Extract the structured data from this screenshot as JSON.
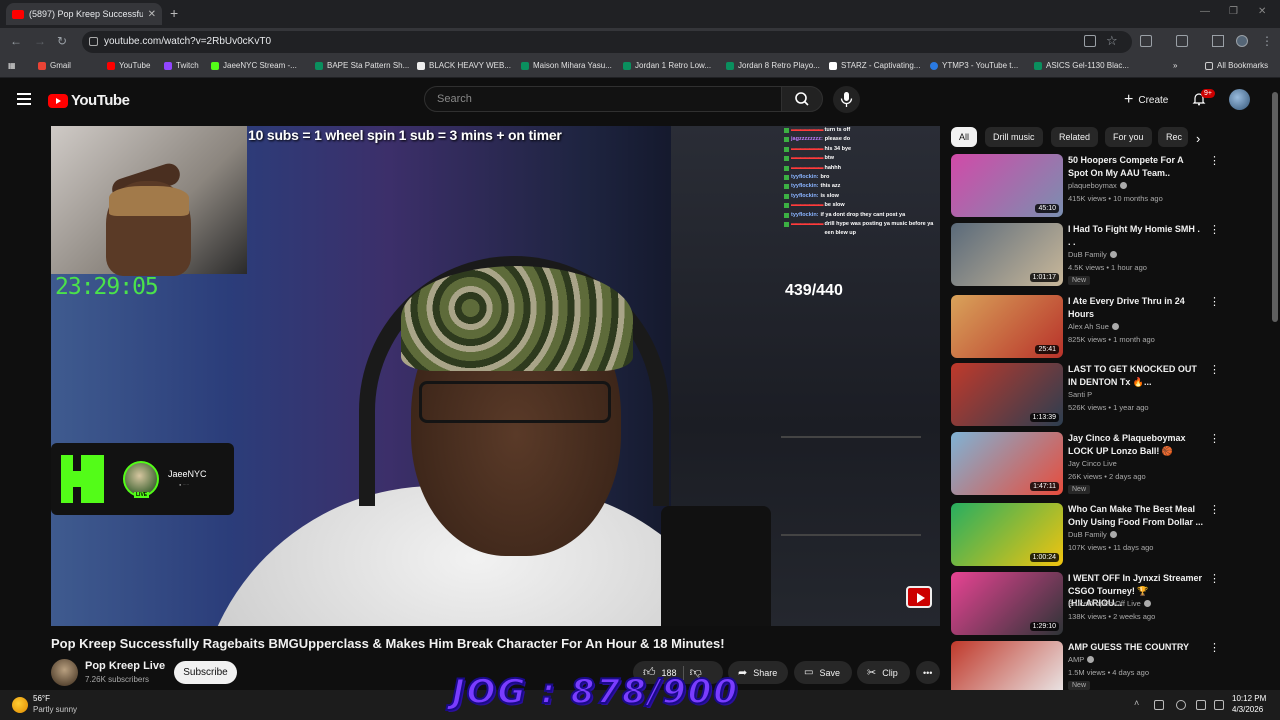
{
  "browser": {
    "tab_title": "(5897) Pop Kreep Successfully R",
    "url": "youtube.com/watch?v=2RbUv0cKvT0",
    "bookmarks": [
      "Gmail",
      "YouTube",
      "Twitch",
      "JaeeNYC Stream -...",
      "BAPE Sta Pattern Sh...",
      "BLACK HEAVY WEB...",
      "Maison Mihara Yasu...",
      "Jordan 1 Retro Low...",
      "Jordan 8 Retro Playo...",
      "STARZ - Captivating...",
      "YTMP3 - YouTube t...",
      "ASICS Gel-1130 Blac..."
    ],
    "all_bookmarks": "All Bookmarks"
  },
  "youtube": {
    "logo": "YouTube",
    "search_placeholder": "Search",
    "create": "Create",
    "notif_badge": "9+"
  },
  "stream": {
    "overlay_text": "10 subs = 1 wheel spin 1 sub = 3 mins + on timer",
    "timer": "23:29:05",
    "sub_goal": "439/440",
    "kick_name": "JaeeNYC",
    "kick_live": "LIVE",
    "chat": [
      {
        "u": "",
        "m": "turn ts off",
        "c": "#ff3b3b"
      },
      {
        "u": "jagzzzzzzzz:",
        "m": "please do",
        "c": "#c07cff"
      },
      {
        "u": "",
        "m": "his 34 bye",
        "c": "#ff3b3b"
      },
      {
        "u": "",
        "m": "btw",
        "c": "#ff3b3b"
      },
      {
        "u": "",
        "m": "hahhh",
        "c": "#ff3b3b"
      },
      {
        "u": "tyyflockin:",
        "m": "bro",
        "c": "#8ab4ff"
      },
      {
        "u": "tyyflockin:",
        "m": "this azz",
        "c": "#8ab4ff"
      },
      {
        "u": "tyyflockin:",
        "m": "is slow",
        "c": "#8ab4ff"
      },
      {
        "u": "",
        "m": "be slow",
        "c": "#ff3b3b"
      },
      {
        "u": "tyyflockin:",
        "m": "if ya dont drop they cant post ya",
        "c": "#8ab4ff"
      },
      {
        "u": "",
        "m": "drill hype was posting ya music before ya een blew up",
        "c": "#ff3b3b"
      }
    ]
  },
  "video": {
    "title": "Pop Kreep Successfully Ragebaits BMGUpperclass & Makes Him Break Character For An Hour & 18 Minutes!",
    "channel": "Pop Kreep Live",
    "subscribers": "7.26K subscribers",
    "subscribe": "Subscribe",
    "likes": "188",
    "share": "Share",
    "save": "Save",
    "clip": "Clip"
  },
  "chips": [
    "All",
    "Drill music",
    "Related",
    "For you",
    "Rec"
  ],
  "recommendations": [
    {
      "title": "50 Hoopers Compete For A Spot On My AAU Team..",
      "channel": "plaqueboymax",
      "meta": "415K views • 10 months ago",
      "duration": "45:10",
      "verified": true,
      "new": false,
      "colors": [
        "#d14aa8",
        "#7a8fb0"
      ]
    },
    {
      "title": "I Had To Fight My Homie SMH . . .",
      "channel": "DuB Family",
      "meta": "4.5K views • 1 hour ago",
      "duration": "1:01:17",
      "verified": true,
      "new": true,
      "colors": [
        "#5a6a7a",
        "#c9b89a"
      ]
    },
    {
      "title": "I Ate Every Drive Thru in 24 Hours",
      "channel": "Alex Ah Sue",
      "meta": "825K views • 1 month ago",
      "duration": "25:41",
      "verified": true,
      "new": false,
      "colors": [
        "#d9a35a",
        "#b8322a"
      ]
    },
    {
      "title": "LAST TO GET KNOCKED OUT IN DENTON Tx 🔥...",
      "channel": "Santi P",
      "meta": "526K views • 1 year ago",
      "duration": "1:13:39",
      "verified": false,
      "new": false,
      "colors": [
        "#c0392b",
        "#2c3e50"
      ]
    },
    {
      "title": "Jay Cinco & Plaqueboymax LOCK UP Lonzo Ball! 🏀",
      "channel": "Jay Cinco Live",
      "meta": "26K views • 2 days ago",
      "duration": "1:47:11",
      "verified": false,
      "new": true,
      "colors": [
        "#7fb3d5",
        "#e74c3c"
      ]
    },
    {
      "title": "Who Can Make The Best Meal Only Using Food From Dollar ...",
      "channel": "DuB Family",
      "meta": "107K views • 11 days ago",
      "duration": "1:00:24",
      "verified": true,
      "new": false,
      "colors": [
        "#27ae60",
        "#f1c40f"
      ]
    },
    {
      "title": "I WENT OFF In Jynxzi Streamer CSGO Tourney! 🏆 (HILARIOU...",
      "channel": "BruceDropEmOff Live",
      "meta": "138K views • 2 weeks ago",
      "duration": "1:29:10",
      "verified": true,
      "new": false,
      "colors": [
        "#e84393",
        "#2d3436"
      ]
    },
    {
      "title": "AMP GUESS THE COUNTRY",
      "channel": "AMP",
      "meta": "1.5M views • 4 days ago",
      "duration": "",
      "verified": true,
      "new": true,
      "colors": [
        "#c0392b",
        "#ecf0f1"
      ]
    }
  ],
  "overlay_bottom": "JOG : 878/900",
  "taskbar": {
    "temp": "56°F",
    "weather": "Partly sunny",
    "time": "10:12 PM",
    "date": "4/3/2026"
  }
}
